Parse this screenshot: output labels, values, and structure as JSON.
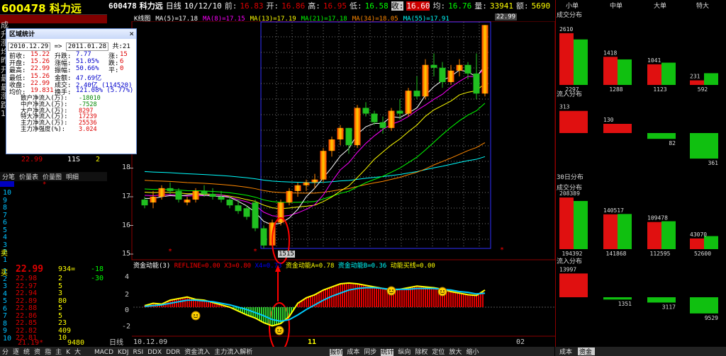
{
  "header": {
    "code_name": "600478 科力远",
    "code": "600478",
    "name": "科力远",
    "period": "日线",
    "date": "10/12/10",
    "prev_label": "前:",
    "prev": "16.83",
    "open_label": "开:",
    "open": "16.86",
    "high_label": "高:",
    "high": "16.95",
    "low_label": "低:",
    "low": "16.58",
    "close_label": "收:",
    "close": "16.60",
    "avg_label": "均:",
    "avg": "16.76",
    "vol_label": "量:",
    "vol": "33941",
    "amt_label": "额:",
    "amt": "5690"
  },
  "ma_line": {
    "k_label": "K线图",
    "ma5": "MA(5)=17.18",
    "ma8": "MA(8)=17.15",
    "ma13": "MA(13)=17.19",
    "ma21": "MA(21)=17.18",
    "ma34": "MA(34)=18.05",
    "ma55": "MA(55)=17.91",
    "max_price": "22.99"
  },
  "left_labels": [
    "成",
    "升",
    "涨",
    "均",
    "昨",
    "开",
    "最",
    "最",
    "涨",
    "跌",
    "1-"
  ],
  "left_price_box": {
    "v1": "22.99",
    "v2": "11S",
    "v3": "2"
  },
  "dialog": {
    "title": "区域统计",
    "start": "2010.12.29",
    "arrow": "=>",
    "end": "2011.01.28",
    "count": "共:21",
    "rows": [
      [
        "前收:",
        "15.22",
        "升跌:",
        "7.77",
        "涨:",
        "15"
      ],
      [
        "开盘:",
        "15.26",
        "涨幅:",
        "51.05%",
        "跌:",
        "6"
      ],
      [
        "最高:",
        "22.99",
        "振幅:",
        "50.66%",
        "平:",
        "0"
      ],
      [
        "最低:",
        "15.26",
        "金额:",
        "47.69亿",
        "",
        ""
      ],
      [
        "收盘:",
        "22.99",
        "成交:",
        "2.40亿 (114520)",
        "",
        ""
      ],
      [
        "均价:",
        "19.831",
        "换手:",
        "121.08% (5.77%)",
        "",
        ""
      ]
    ],
    "flows": [
      [
        "散户净流入(万):",
        "-18010"
      ],
      [
        "中户净流入(万):",
        "-7528"
      ],
      [
        "大户净流入(万):",
        "8297"
      ],
      [
        "特大净流入(万):",
        "17239"
      ],
      [
        "主力净流入(万):",
        "25536"
      ],
      [
        "主力净强度(%):",
        "3.024"
      ]
    ]
  },
  "tabs1": [
    "分笔",
    "价量表",
    "价量图",
    "明细"
  ],
  "ticks": [
    {
      "price": "22.99",
      "vol": "934=",
      "chg": "-18"
    },
    {
      "price": "22.98",
      "vol": "2",
      "chg": "-30"
    },
    {
      "price": "22.97",
      "vol": "5",
      "chg": ""
    },
    {
      "price": "22.94",
      "vol": "3",
      "chg": ""
    },
    {
      "price": "22.89",
      "vol": "80",
      "chg": ""
    },
    {
      "price": "22.88",
      "vol": "5",
      "chg": ""
    },
    {
      "price": "22.86",
      "vol": "5",
      "chg": ""
    },
    {
      "price": "22.85",
      "vol": "23",
      "chg": ""
    },
    {
      "price": "22.82",
      "vol": "409",
      "chg": ""
    },
    {
      "price": "22.81",
      "vol": "10",
      "chg": ""
    }
  ],
  "side_numbers": [
    "10",
    "9",
    "8",
    "7",
    "6",
    "5",
    "4",
    "3",
    "2",
    "1",
    "1",
    "2",
    "3",
    "4",
    "5",
    "6",
    "7",
    "8",
    "9",
    "10"
  ],
  "bottom_tick": {
    "price": "21.19*",
    "vol": "9480"
  },
  "left_vert": [
    "卖",
    "买"
  ],
  "price_axis": [
    "18",
    "17",
    "16",
    "15"
  ],
  "cursor_labels": {
    "p1": "15",
    "p2": "15",
    "marker": "*"
  },
  "indicator": {
    "title": "资金动能(3)",
    "refline": "REFLINE=0.00",
    "x3": "X3=0.80",
    "x4": "X4=0.73",
    "a": "资金动能A=0.78",
    "b": "资金动能B=0.36",
    "c": "动能买线=0.00",
    "axis": [
      "4",
      "2",
      "0",
      "-2"
    ]
  },
  "date_axis": {
    "d1": "10.12.09",
    "d2": "11",
    "d3": "02"
  },
  "period_btn": "日线",
  "bottombar": [
    "MACD",
    "KDJ",
    "RSI",
    "DDX",
    "DDR",
    "资金流入",
    "主力流入解析"
  ],
  "bottombar_right": [
    "报价",
    "成本",
    "同步",
    "统计",
    "纵向",
    "除权",
    "定位",
    "放大",
    "缩小"
  ],
  "bottom_left": [
    "分",
    "逐",
    "统",
    "资",
    "指",
    "主",
    "K",
    "大"
  ],
  "rightpanel": {
    "headers": [
      "小单",
      "中单",
      "大单",
      "特大"
    ],
    "sec1": "成交分布",
    "sec2": "流入分布",
    "sec3": "30日分布",
    "sec4": "成交分布",
    "sec5": "流入分布",
    "dist1": [
      {
        "buy": "2610",
        "sell": "2297"
      },
      {
        "buy": "1418",
        "sell": "1288"
      },
      {
        "buy": "1041",
        "sell": "1123"
      },
      {
        "buy": "231",
        "sell": "592"
      }
    ],
    "flow1": [
      "313",
      "130",
      "-82",
      "-361"
    ],
    "dist30": [
      {
        "buy": "208389",
        "sell": "194392"
      },
      {
        "buy": "140517",
        "sell": "141868"
      },
      {
        "buy": "109478",
        "sell": "112595"
      },
      {
        "buy": "43070",
        "sell": "52600"
      }
    ],
    "flow30": [
      "13997",
      "-1351",
      "-3117",
      "-9529"
    ],
    "tabs": [
      "成本",
      "资金"
    ]
  },
  "chart_data": {
    "type": "candlestick",
    "ylim": [
      15,
      23
    ],
    "candles": [
      [
        16.9,
        17.0,
        16.6,
        16.7
      ],
      [
        16.8,
        17.2,
        16.6,
        17.0
      ],
      [
        17.0,
        17.4,
        16.9,
        17.3
      ],
      [
        17.3,
        17.5,
        17.1,
        17.2
      ],
      [
        17.2,
        17.3,
        16.8,
        16.9
      ],
      [
        16.8,
        17.0,
        16.7,
        16.9
      ],
      [
        16.9,
        17.3,
        16.8,
        17.2
      ],
      [
        17.2,
        17.4,
        17.0,
        17.1
      ],
      [
        17.1,
        17.3,
        16.9,
        17.0
      ],
      [
        17.0,
        17.2,
        16.8,
        16.9
      ],
      [
        16.9,
        17.0,
        16.6,
        16.7
      ],
      [
        16.7,
        16.9,
        16.4,
        16.5
      ],
      [
        16.6,
        16.7,
        16.2,
        16.3
      ],
      [
        16.8,
        16.9,
        15.8,
        15.9
      ],
      [
        15.9,
        16.0,
        15.2,
        15.3
      ],
      [
        15.3,
        16.2,
        15.26,
        16.1
      ],
      [
        16.1,
        16.9,
        16.0,
        16.8
      ],
      [
        16.8,
        17.3,
        16.7,
        17.2
      ],
      [
        17.2,
        17.5,
        17.0,
        17.4
      ],
      [
        17.4,
        17.6,
        17.2,
        17.5
      ],
      [
        17.5,
        17.8,
        17.3,
        17.6
      ],
      [
        17.6,
        18.7,
        17.5,
        18.6
      ],
      [
        18.6,
        19.1,
        18.4,
        19.0
      ],
      [
        19.0,
        19.5,
        18.8,
        19.4
      ],
      [
        19.4,
        19.4,
        18.5,
        18.8
      ],
      [
        18.8,
        20.2,
        18.7,
        20.1
      ],
      [
        20.1,
        20.3,
        19.8,
        19.9
      ],
      [
        19.9,
        20.0,
        19.5,
        19.6
      ],
      [
        19.6,
        19.8,
        19.2,
        19.4
      ],
      [
        19.4,
        20.1,
        19.3,
        20.0
      ],
      [
        20.0,
        20.4,
        19.7,
        19.9
      ],
      [
        19.9,
        20.8,
        19.8,
        20.7
      ],
      [
        20.7,
        21.2,
        20.4,
        20.5
      ],
      [
        20.5,
        21.8,
        20.4,
        21.6
      ],
      [
        21.6,
        22.0,
        21.2,
        21.5
      ],
      [
        21.5,
        21.7,
        20.8,
        21.0
      ],
      [
        21.0,
        21.6,
        20.9,
        21.4
      ],
      [
        21.4,
        21.8,
        21.2,
        21.6
      ],
      [
        21.6,
        21.7,
        21.1,
        21.3
      ],
      [
        21.3,
        22.0,
        20.4,
        20.6
      ],
      [
        20.6,
        22.99,
        20.5,
        22.99
      ]
    ],
    "indicator_a": [
      0.2,
      0.5,
      0.4,
      0.9,
      1.1,
      1.3,
      1.0,
      0.9,
      0.6,
      0.3,
      0.0,
      -0.5,
      -1.0,
      -1.4,
      -2.0,
      -2.4,
      -2.1,
      -1.2,
      0.5,
      1.2,
      1.6,
      2.2,
      2.6,
      3.0,
      3.1,
      3.0,
      2.8,
      2.6,
      2.4,
      2.2,
      2.3,
      2.5,
      2.7,
      2.6,
      2.5,
      2.3,
      2.0,
      1.8,
      1.6,
      1.5,
      2.2
    ],
    "indicator_b": [
      0.1,
      0.2,
      0.3,
      0.5,
      0.7,
      0.9,
      0.9,
      0.8,
      0.7,
      0.5,
      0.3,
      0.0,
      -0.3,
      -0.7,
      -1.1,
      -1.6,
      -1.8,
      -1.6,
      -1.0,
      -0.3,
      0.3,
      0.9,
      1.4,
      1.8,
      2.2,
      2.4,
      2.5,
      2.5,
      2.4,
      2.3,
      2.3,
      2.3,
      2.4,
      2.4,
      2.4,
      2.3,
      2.2,
      2.0,
      1.9,
      1.7,
      1.8
    ]
  }
}
